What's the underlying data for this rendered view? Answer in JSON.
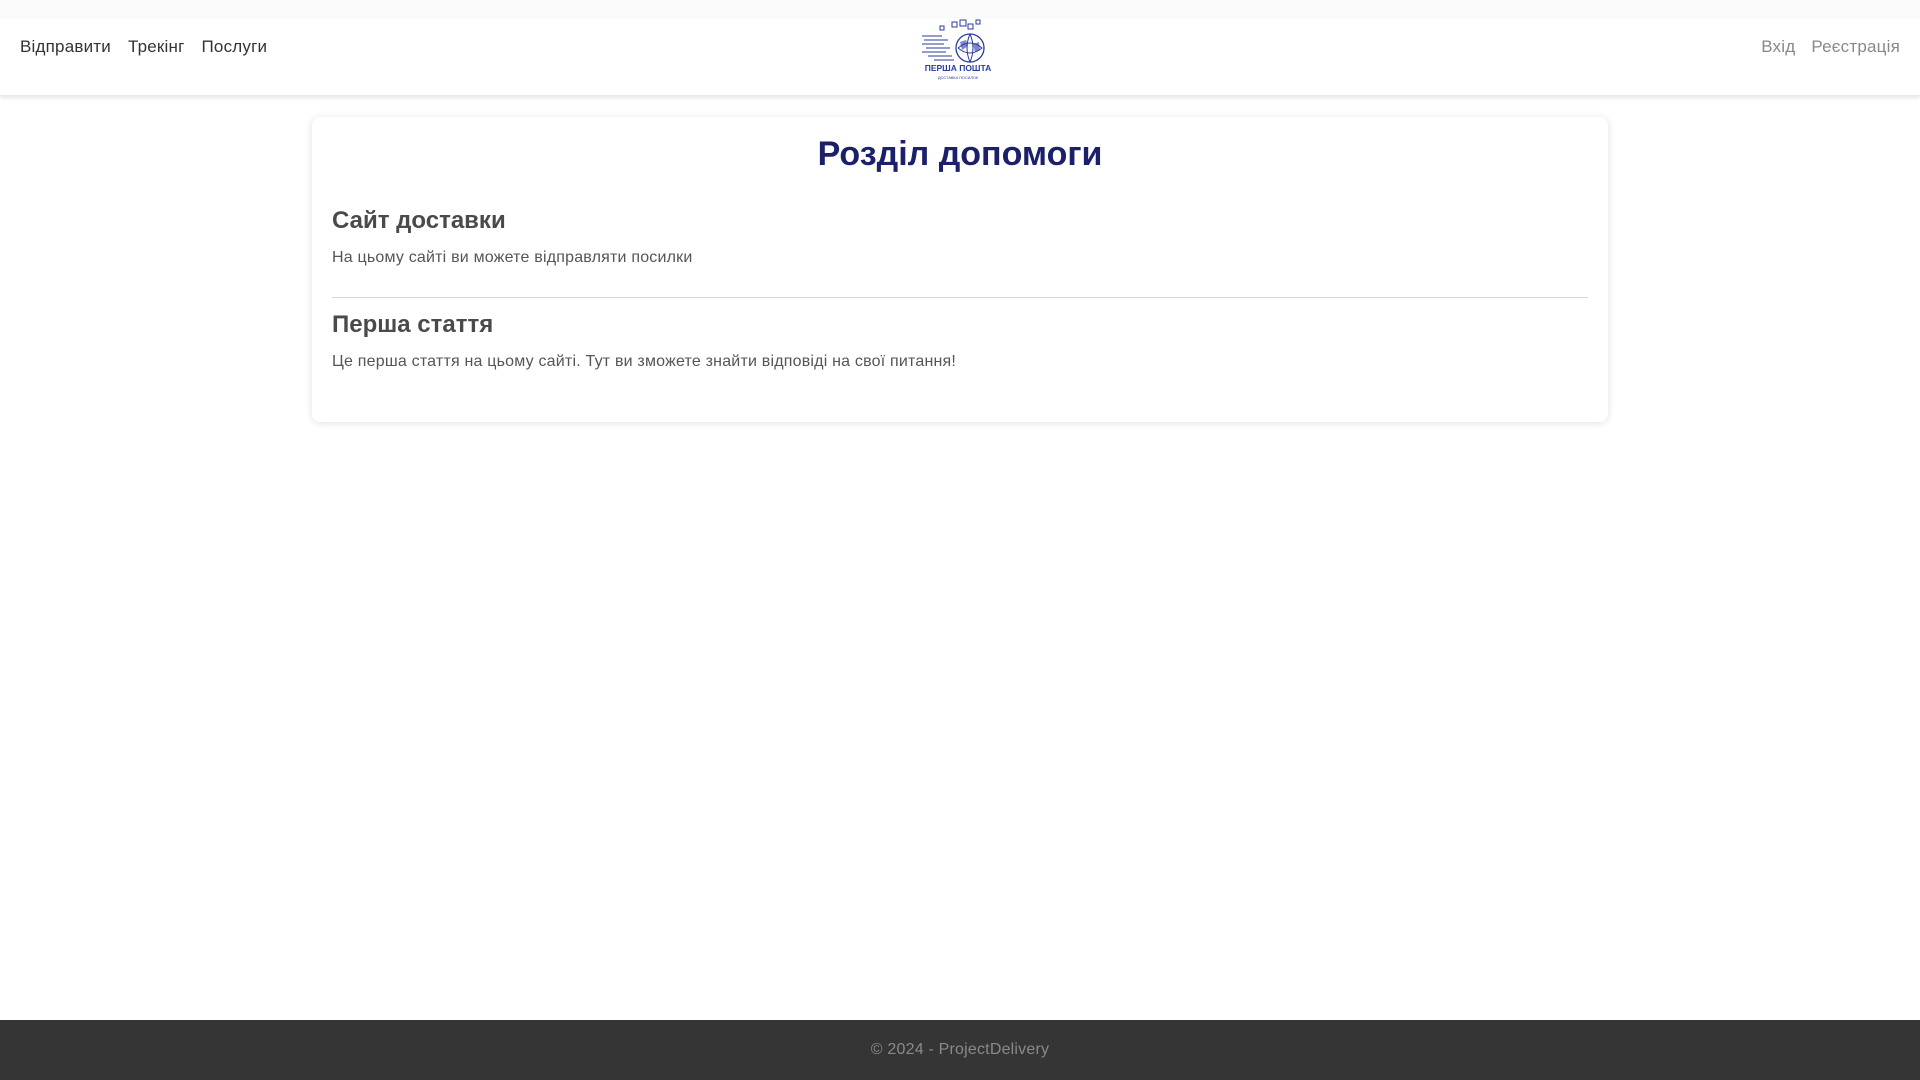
{
  "navbar": {
    "left_links": [
      {
        "label": "Відправити"
      },
      {
        "label": "Трекінг"
      },
      {
        "label": "Послуги"
      }
    ],
    "right_links": [
      {
        "label": "Вхід"
      },
      {
        "label": "Реєстрація"
      }
    ],
    "logo": {
      "text_main": "ПЕРША ПОШТА",
      "text_sub": "ДОСТАВКА ПОСИЛОК",
      "color": "#2a3aa0"
    }
  },
  "main": {
    "title": "Розділ допомоги",
    "articles": [
      {
        "heading": "Сайт доставки",
        "body": "На цьому сайті ви можете відправляти посилки"
      },
      {
        "heading": "Перша стаття",
        "body": "Це перша стаття на цьому сайті. Тут ви зможете знайти відповіді на свої питання!"
      }
    ]
  },
  "footer": {
    "text": "© 2024 - ProjectDelivery"
  },
  "colors": {
    "title": "#1b2068",
    "footer_bg": "#353535",
    "accent": "#2a3aa0"
  }
}
